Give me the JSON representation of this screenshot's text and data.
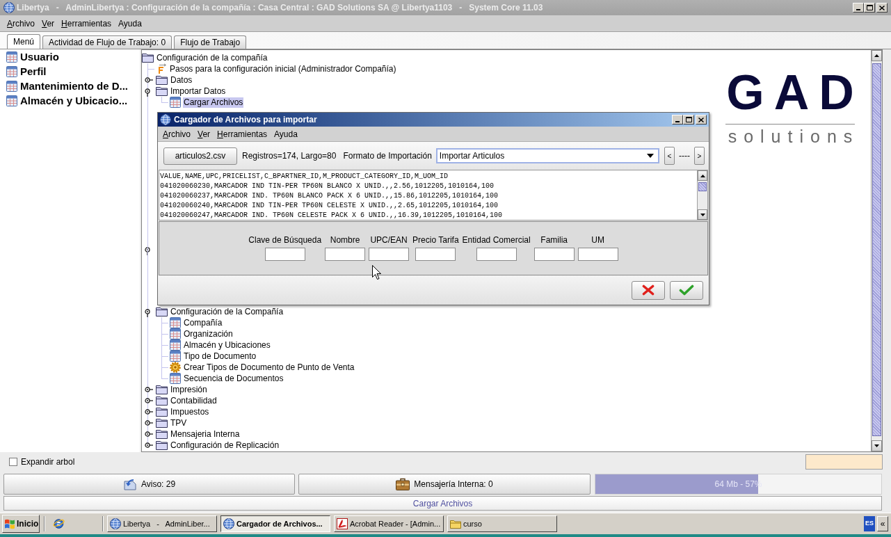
{
  "window": {
    "title": "Libertya   -   AdminLibertya : Configuración de la compañía : Casa Central : GAD Solutions SA @ Libertya1103   -   System Core 11.03"
  },
  "menu": [
    {
      "label": "Archivo",
      "mnemonic": true
    },
    {
      "label": "Ver",
      "mnemonic": true
    },
    {
      "label": "Herramientas",
      "mnemonic": true
    },
    {
      "label": "Ayuda",
      "mnemonic": false
    }
  ],
  "tabs": [
    {
      "label": "Menú",
      "selected": true
    },
    {
      "label": "Actividad de Flujo de Trabajo: 0",
      "selected": false
    },
    {
      "label": "Flujo de Trabajo",
      "selected": false
    }
  ],
  "favorites": [
    {
      "label": "Usuario"
    },
    {
      "label": "Perfil"
    },
    {
      "label": "Mantenimiento de D..."
    },
    {
      "label": "Almacén y Ubicacio..."
    }
  ],
  "tree": {
    "label": "Configuración de la compañía",
    "kind": "folder",
    "selected": false,
    "children": [
      {
        "label": "Pasos para la configuración inicial (Administrador Compañía)",
        "kind": "workflow",
        "selected": false
      },
      {
        "label": "Datos",
        "kind": "folder",
        "expanded": false,
        "selected": false
      },
      {
        "label": "Importar Datos",
        "kind": "folder",
        "expanded": true,
        "selected": false,
        "children": [
          {
            "label": "Cargar Archivos",
            "kind": "window",
            "selected": true
          }
        ]
      },
      {
        "kind": "covered",
        "expanded": true
      },
      {
        "label": "Configuración de la Compañía",
        "kind": "folder",
        "expanded": true,
        "selected": false,
        "children": [
          {
            "label": "Compañía",
            "kind": "window",
            "selected": false
          },
          {
            "label": "Organización",
            "kind": "window",
            "selected": false
          },
          {
            "label": "Almacén y Ubicaciones",
            "kind": "window",
            "selected": false
          },
          {
            "label": "Tipo de Documento",
            "kind": "window",
            "selected": false
          },
          {
            "label": "Crear Tipos de Documento de Punto de Venta",
            "kind": "process",
            "selected": false
          },
          {
            "label": "Secuencia de Documentos",
            "kind": "window",
            "selected": false
          }
        ]
      },
      {
        "label": "Impresión",
        "kind": "folder",
        "expanded": false,
        "selected": false
      },
      {
        "label": "Contabilidad",
        "kind": "folder",
        "expanded": false,
        "selected": false
      },
      {
        "label": "Impuestos",
        "kind": "folder",
        "expanded": false,
        "selected": false
      },
      {
        "label": "TPV",
        "kind": "folder",
        "expanded": false,
        "selected": false
      },
      {
        "label": "Mensajeria Interna",
        "kind": "folder",
        "expanded": false,
        "selected": false
      },
      {
        "label": "Configuración de Replicación",
        "kind": "folder",
        "expanded": false,
        "selected": false
      }
    ]
  },
  "logo": {
    "mark": "GAD",
    "tagline": "solutions"
  },
  "expand_tree": {
    "label": "Expandir arbol",
    "checked": false
  },
  "status_buttons": [
    {
      "kind": "notice",
      "label": "Aviso: 29"
    },
    {
      "kind": "messages",
      "label": "Mensajería Interna: 0"
    }
  ],
  "memory": {
    "label": "64 Mb - 57%",
    "level": 0.57
  },
  "status_bar": {
    "text": "Cargar Archivos"
  },
  "dialog": {
    "title": "Cargador de Archivos para importar",
    "menu": [
      {
        "label": "Archivo",
        "mnemonic": true
      },
      {
        "label": "Ver",
        "mnemonic": true
      },
      {
        "label": "Herramientas",
        "mnemonic": true
      },
      {
        "label": "Ayuda",
        "mnemonic": false
      }
    ],
    "file_button": "articulos2.csv",
    "records_info": "Registros=174, Largo=80",
    "format": {
      "label": "Formato de Importación",
      "value": "Importar Articulos"
    },
    "navigation": {
      "previous": "<",
      "position": "----",
      "next": ">"
    },
    "preview_lines": [
      "VALUE,NAME,UPC,PRICELIST,C_BPARTNER_ID,M_PRODUCT_CATEGORY_ID,M_UOM_ID",
      "041020060230,MARCADOR IND TIN-PER TP60N BLANCO X UNID.,,2.56,1012205,1010164,100",
      "041020060237,MARCADOR IND. TP60N BLANCO PACK X 6 UNID.,,15.86,1012205,1010164,100",
      "041020060240,MARCADOR IND TIN-PER TP60N CELESTE X UNID.,,2.65,1012205,1010164,100",
      "041020060247,MARCADOR IND. TP60N CELESTE PACK X 6 UNID.,,16.39,1012205,1010164,100"
    ],
    "field_labels": [
      "Clave de Búsqueda",
      "Nombre",
      "UPC/EAN",
      "Precio Tarifa",
      "Entidad Comercial",
      "Familia",
      "UM"
    ]
  },
  "taskbar": {
    "start": "Inicio",
    "tasks": [
      {
        "label": "Libertya   -   AdminLiber...",
        "kind": "app",
        "selected": false
      },
      {
        "label": "Cargador de Archivos...",
        "kind": "app",
        "selected": true
      },
      {
        "label": "Acrobat Reader - [Admin...",
        "kind": "pdf",
        "selected": false
      },
      {
        "label": "curso",
        "kind": "folder",
        "selected": false
      }
    ],
    "language": "ES",
    "tray_toggle": "«"
  }
}
